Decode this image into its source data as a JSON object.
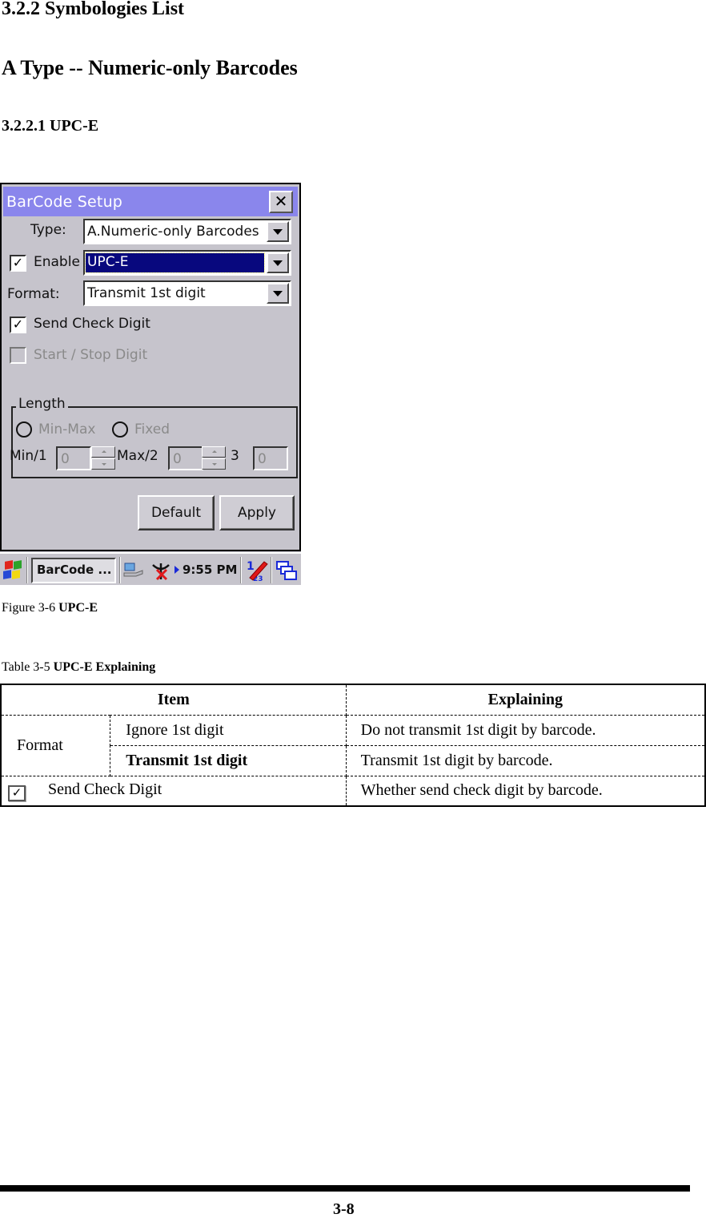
{
  "doc": {
    "section_heading": "3.2.2 Symbologies List",
    "type_heading": "A Type -- Numeric-only Barcodes",
    "subsection_heading": "3.2.2.1 UPC-E",
    "figure_caption_prefix": "Figure 3-6 ",
    "figure_caption_title": "UPC-E",
    "table_caption_prefix": "Table 3-5 ",
    "table_caption_title": "UPC-E Explaining",
    "page_number": "3-8"
  },
  "dialog": {
    "title": "BarCode Setup",
    "close_glyph": "✕",
    "type_label": "Type:",
    "type_value": "A.Numeric-only Barcodes",
    "enable_label": "Enable",
    "enable_checked": true,
    "symbology_value": "UPC-E",
    "format_label": "Format:",
    "format_value": "Transmit 1st digit",
    "send_check_digit_label": "Send Check Digit",
    "send_check_digit_checked": true,
    "start_stop_label": "Start / Stop Digit",
    "start_stop_checked": false,
    "check_glyph": "✓",
    "length_group": {
      "legend": "Length",
      "radio_minmax": "Min-Max",
      "radio_fixed": "Fixed",
      "min_label": "Min/1",
      "min_value": "0",
      "max_label": "Max/2",
      "max_value": "0",
      "third_label": "3",
      "third_value": "0"
    },
    "default_button": "Default",
    "apply_button": "Apply"
  },
  "taskbar": {
    "task_button": "BarCode ...",
    "clock": "9:55 PM",
    "ime_digit_top": "1",
    "ime_digits_bottom": "23",
    "colors": {
      "titlebar": "#8a86ec",
      "selection": "#08087e"
    }
  },
  "table": {
    "headers": [
      "Item",
      "Explaining"
    ],
    "rows": [
      {
        "group": "Format",
        "option": "Ignore 1st digit",
        "option_bold": false,
        "explaining": "Do not transmit 1st digit by barcode."
      },
      {
        "group": "Format",
        "option": "Transmit 1st digit",
        "option_bold": true,
        "explaining": "Transmit 1st digit by barcode."
      },
      {
        "item": "Send Check Digit",
        "checkbox_checked": true,
        "explaining": "Whether send check digit by barcode."
      }
    ],
    "check_glyph": "✓"
  }
}
